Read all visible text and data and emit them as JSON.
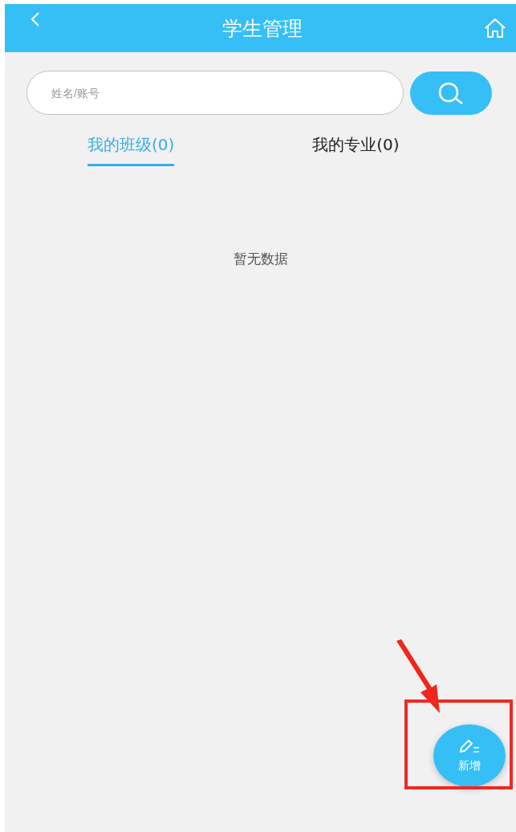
{
  "header": {
    "title": "学生管理"
  },
  "search": {
    "placeholder": "姓名/账号"
  },
  "tabs": [
    {
      "label": "我的班级(0)",
      "selected": true
    },
    {
      "label": "我的专业(0)",
      "selected": false
    }
  ],
  "empty_message": "暂无数据",
  "fab": {
    "label": "新增"
  }
}
